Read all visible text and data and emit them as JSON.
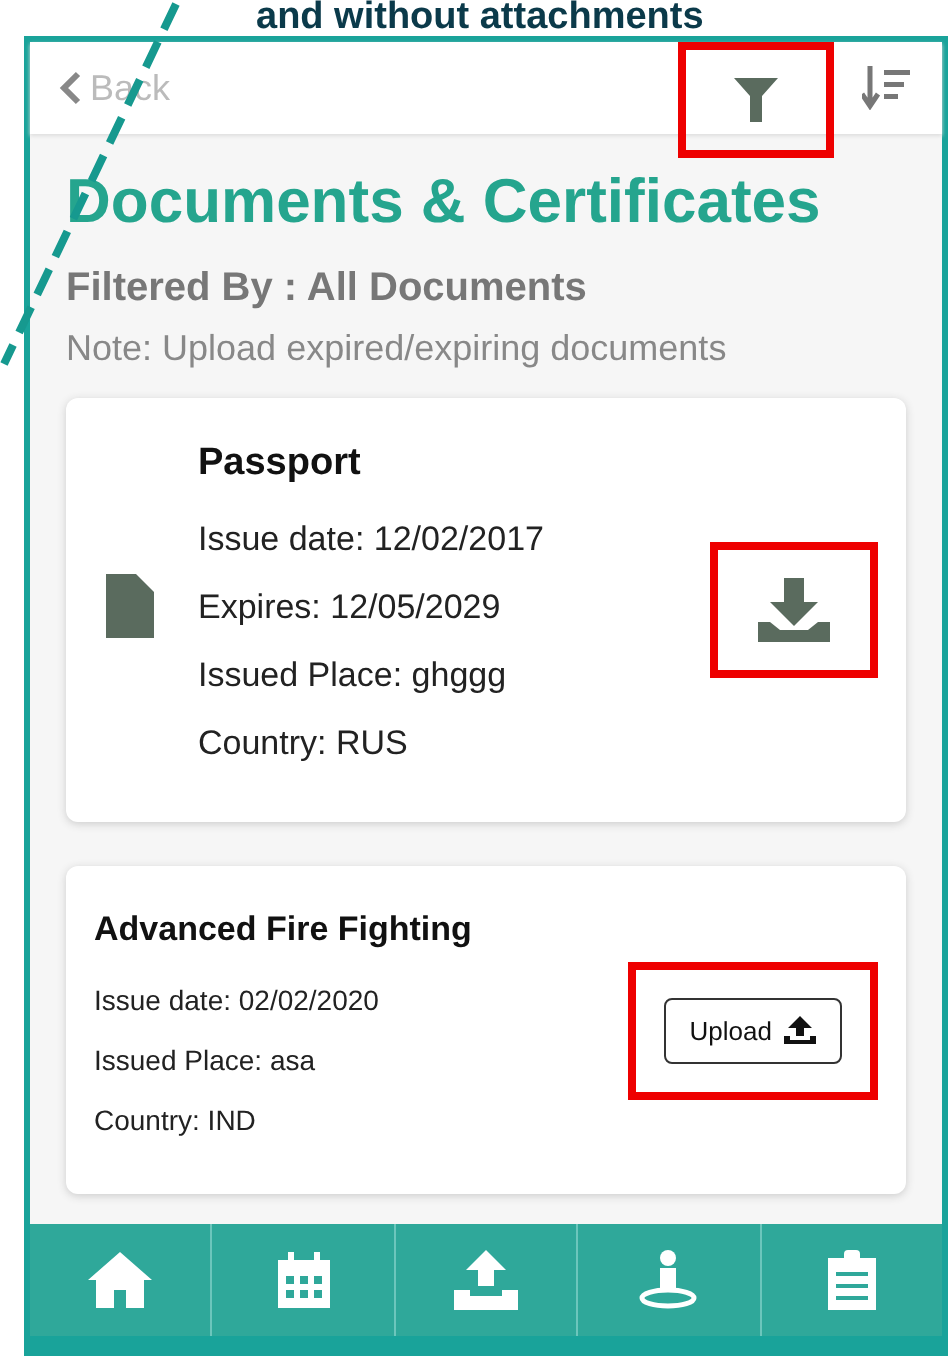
{
  "caption": "and without attachments",
  "header": {
    "back": "Back",
    "filter_highlighted": true
  },
  "title": "Documents & Certificates",
  "filter": "Filtered By : All Documents",
  "note": "Note: Upload expired/expiring documents",
  "documents": [
    {
      "kind": "download",
      "name": "Passport",
      "lines": [
        "Issue date: 12/02/2017",
        "Expires: 12/05/2029",
        "Issued Place: ghggg",
        "Country: RUS"
      ],
      "highlighted": true
    },
    {
      "kind": "upload",
      "name": "Advanced Fire Fighting",
      "lines": [
        "Issue date: 02/02/2020",
        "Issued Place: asa",
        "Country: IND"
      ],
      "button": "Upload",
      "highlighted": true
    }
  ],
  "nav": [
    {
      "kind": "home"
    },
    {
      "kind": "calendar"
    },
    {
      "kind": "upload"
    },
    {
      "kind": "person"
    },
    {
      "kind": "clipboard"
    }
  ]
}
